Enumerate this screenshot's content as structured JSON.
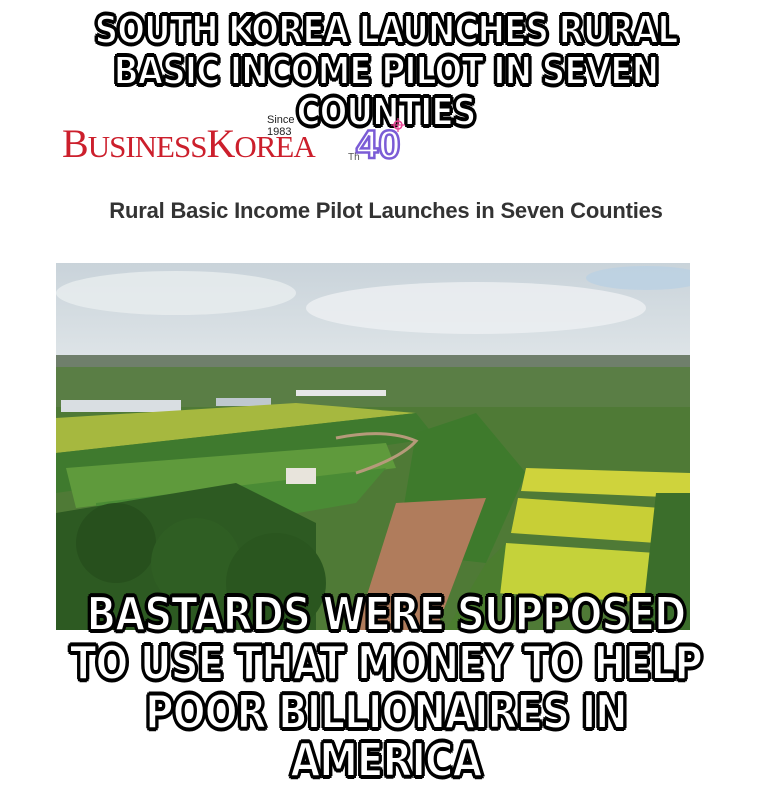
{
  "top_caption": {
    "line1": "SOUTH KOREA LAUNCHES RURAL",
    "line2": "BASIC INCOME PILOT IN SEVEN COUNTIES"
  },
  "logo": {
    "business": "BUSINESS",
    "korea": "KOREA",
    "since": "Since 1983",
    "anniversary": "40",
    "anniversary_suffix": "Th",
    "brand_color": "#cc1f2c",
    "badge_color": "#7b5cd6"
  },
  "article": {
    "headline": "Rural Basic Income Pilot Launches in Seven Counties"
  },
  "photo": {
    "icon": "aerial-farmland-photo"
  },
  "bottom_caption": {
    "line1": "BASTARDS WERE SUPPOSED",
    "line2": "TO USE THAT MONEY TO HELP",
    "line3": "POOR BILLIONAIRES IN AMERICA"
  }
}
